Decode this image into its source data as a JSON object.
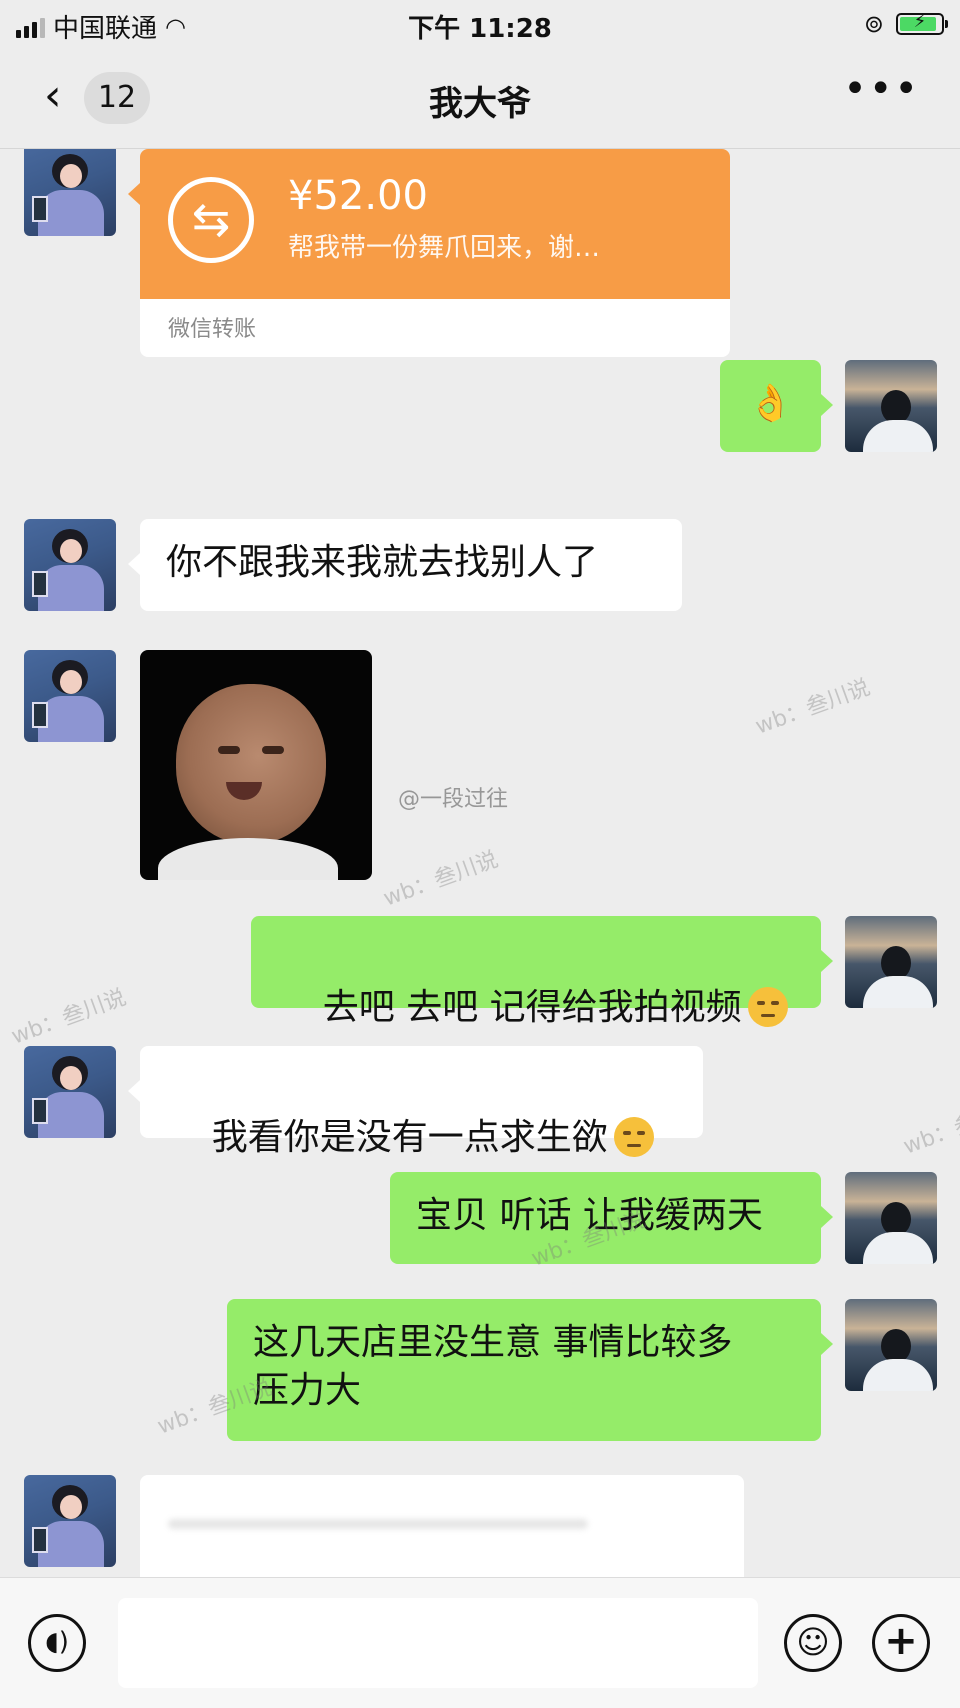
{
  "status_bar": {
    "carrier": "中国联通",
    "time": "下午 11:28"
  },
  "header": {
    "back_label": "‹",
    "unread_count": "12",
    "title": "我大爷",
    "more_label": "•••"
  },
  "messages": {
    "transfer": {
      "amount": "¥52.00",
      "note": "帮我带一份舞爪回来，谢…",
      "footer": "微信转账"
    },
    "m1": {
      "text": "👌"
    },
    "m2": {
      "text": "你不跟我来我就去找别人了"
    },
    "m4": {
      "text": "去吧 去吧 记得给我拍视频"
    },
    "m5": {
      "text": "我看你是没有一点求生欲"
    },
    "m6": {
      "text": "宝贝 听话 让我缓两天"
    },
    "m7": {
      "text": "这几天店里没生意 事情比较多\n压力大"
    }
  },
  "watermarks": {
    "wb1": "wb：叁川说",
    "wb2": "wb：叁川说",
    "wb3": "wb：叁川说",
    "wb4": "wb：叁川说",
    "wb5": "wb：叁川说",
    "wb6": "wb：叁川说",
    "weibo_user": "@一段过往"
  },
  "colors": {
    "background": "#ededed",
    "green_bubble": "#95ec69",
    "transfer_orange": "#f79c46"
  }
}
